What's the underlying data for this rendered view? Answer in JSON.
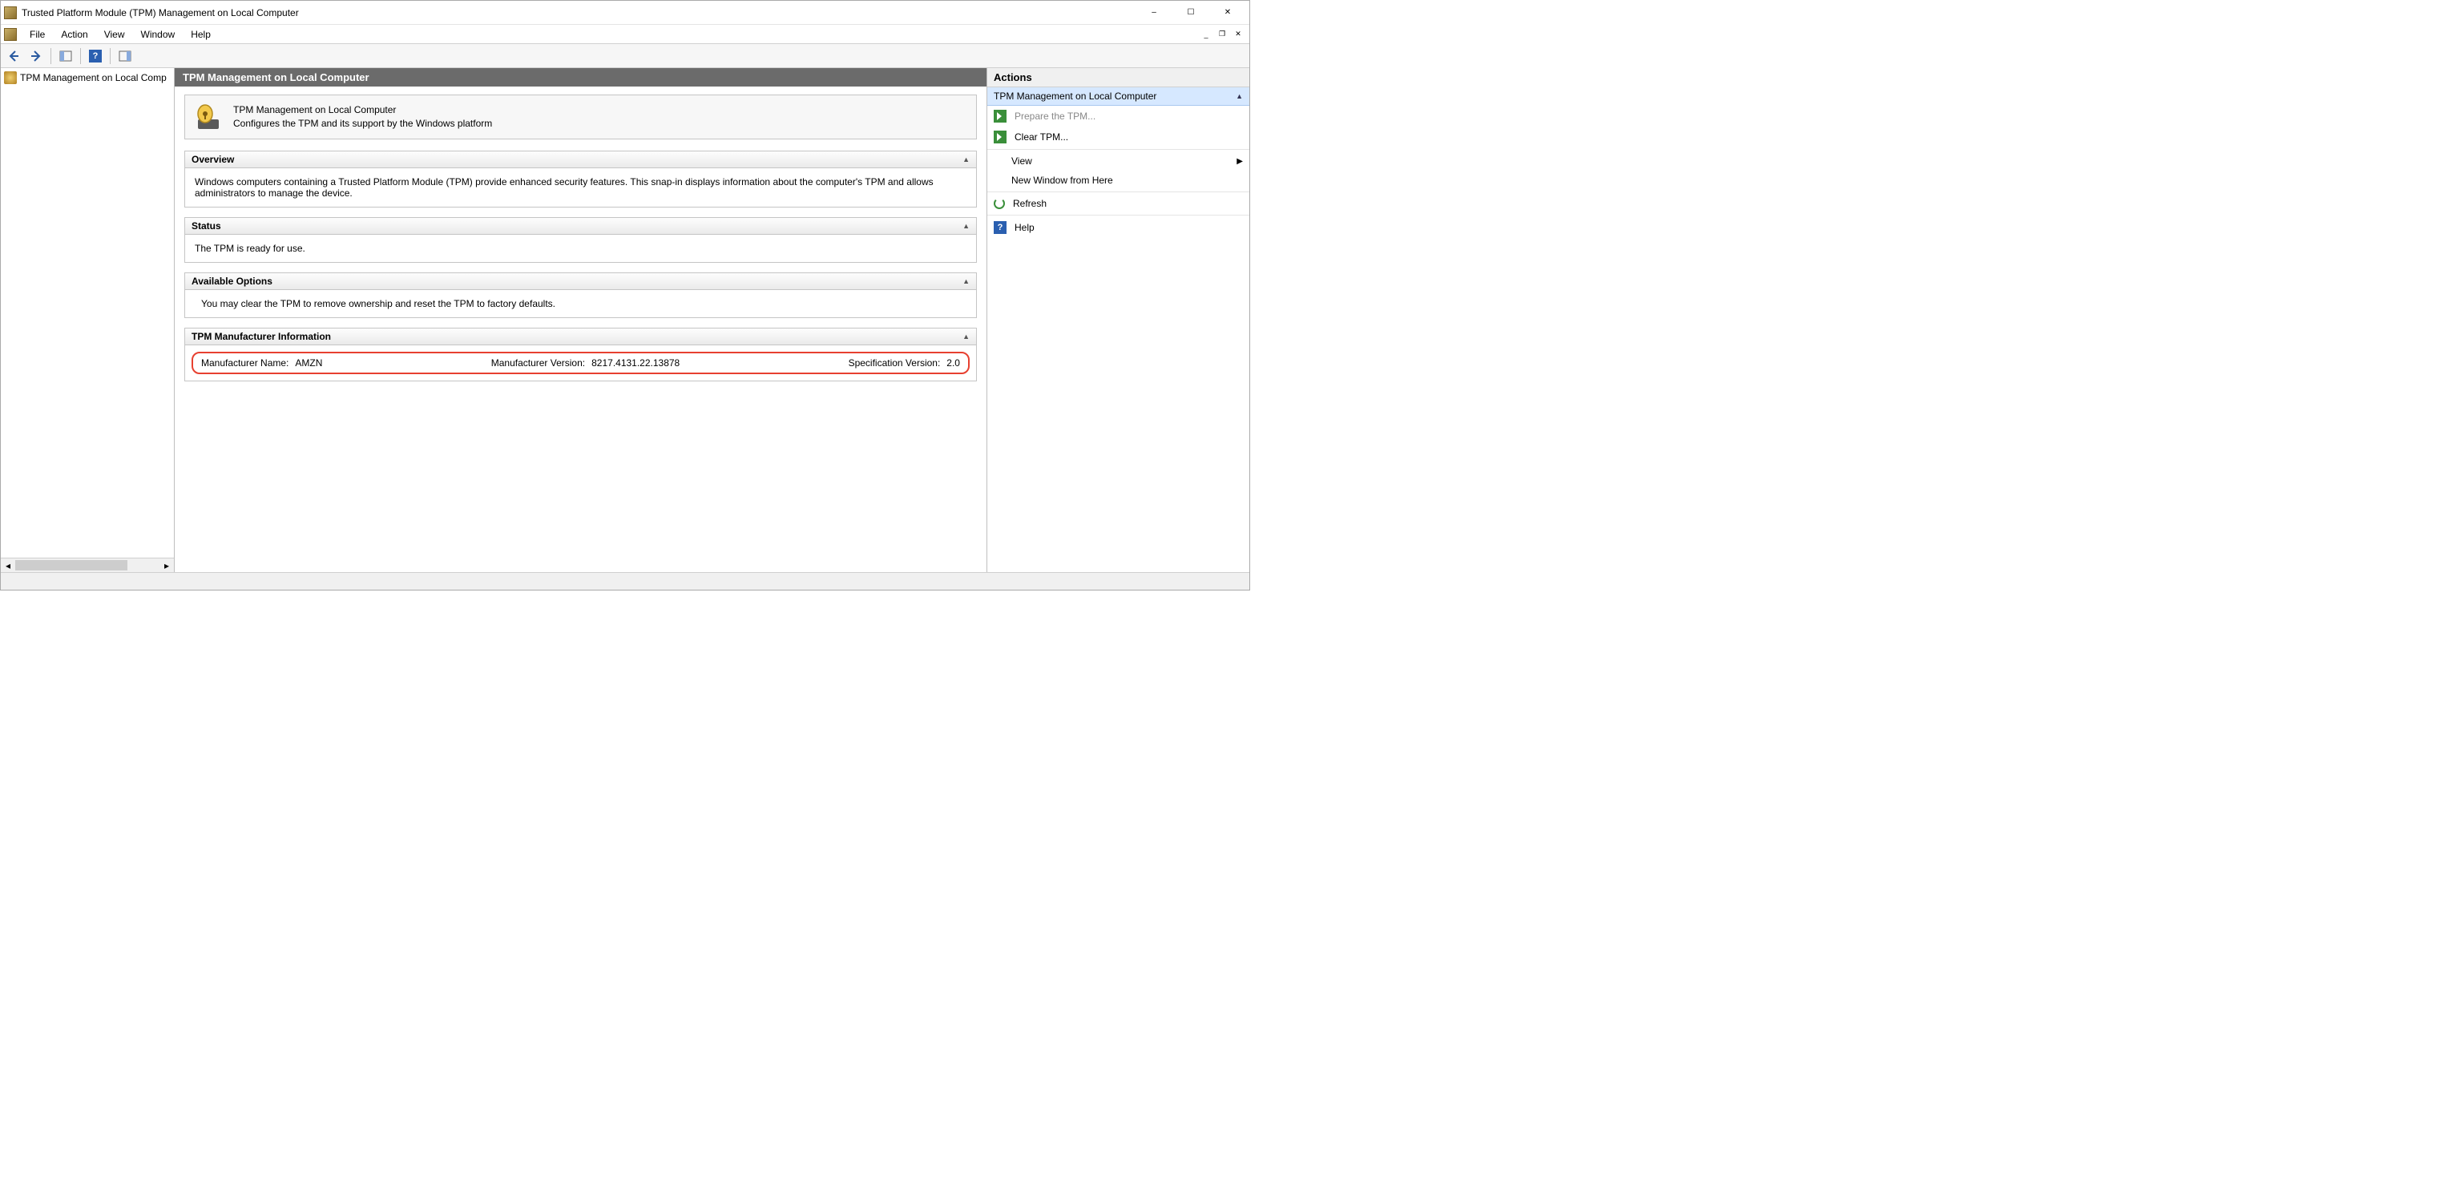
{
  "window": {
    "title": "Trusted Platform Module (TPM) Management on Local Computer"
  },
  "menubar": {
    "items": [
      "File",
      "Action",
      "View",
      "Window",
      "Help"
    ]
  },
  "tree": {
    "root_label": "TPM Management on Local Comp"
  },
  "center": {
    "header": "TPM Management on Local Computer",
    "info_title": "TPM Management on Local Computer",
    "info_sub": "Configures the TPM and its support by the Windows platform",
    "sections": {
      "overview": {
        "title": "Overview",
        "body": "Windows computers containing a Trusted Platform Module (TPM) provide enhanced security features. This snap-in displays information about the computer's TPM and allows administrators to manage the device."
      },
      "status": {
        "title": "Status",
        "body": "The TPM is ready for use."
      },
      "options": {
        "title": "Available Options",
        "body": "You may clear the TPM to remove ownership and reset the TPM to factory defaults."
      },
      "manufacturer": {
        "title": "TPM Manufacturer Information",
        "name_label": "Manufacturer Name:",
        "name_value": "AMZN",
        "version_label": "Manufacturer Version:",
        "version_value": "8217.4131.22.13878",
        "spec_label": "Specification Version:",
        "spec_value": "2.0"
      }
    }
  },
  "actions": {
    "title": "Actions",
    "group_header": "TPM Management on Local Computer",
    "items": {
      "prepare": "Prepare the TPM...",
      "clear": "Clear TPM...",
      "view": "View",
      "new_window": "New Window from Here",
      "refresh": "Refresh",
      "help": "Help"
    }
  }
}
